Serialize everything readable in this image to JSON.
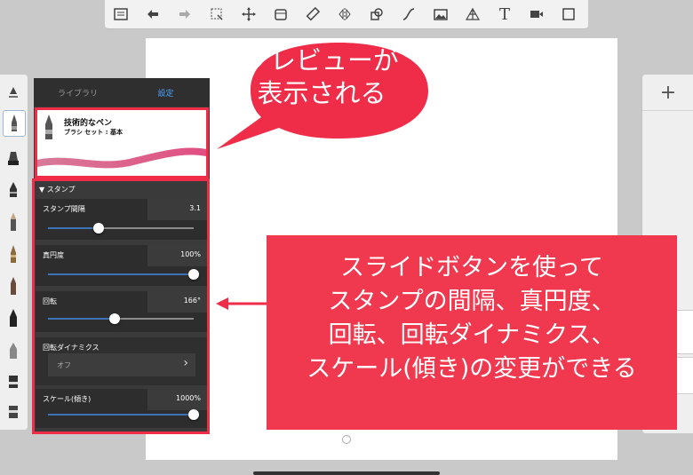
{
  "toolbar": {
    "icons": [
      "list-icon",
      "undo-icon",
      "redo-icon",
      "select-icon",
      "transform-icon",
      "layer-icon",
      "ruler-icon",
      "symmetry-icon",
      "shape-icon",
      "curve-icon",
      "image-icon",
      "perspective-icon",
      "text-icon",
      "video-icon",
      "fullscreen-icon"
    ],
    "text_tool_glyph": "T"
  },
  "brush_panel": {
    "tabs": {
      "library": "ライブラリ",
      "settings": "設定"
    },
    "preview": {
      "brush_name": "技術的なペン",
      "brush_set": "ブラシ セット : 基本"
    },
    "section": "▼ スタンプ",
    "stamp_spacing": {
      "label": "スタンプ間隔",
      "value": "3.1",
      "level": 0.35
    },
    "roundness": {
      "label": "真円度",
      "value": "100%",
      "level": 1.0
    },
    "rotation": {
      "label": "回転",
      "value": "166°",
      "level": 0.46
    },
    "rotation_dynamics": {
      "label": "回転ダイナミクス",
      "value": "オフ",
      "chevron": "›"
    },
    "scale": {
      "label": "スケール(傾き)",
      "value": "1000%",
      "level": 1.0
    }
  },
  "right_panel": {
    "add_label": "+"
  },
  "annotations": {
    "bubble_text": "プレビューが 表示される",
    "bubble_line1": "プレビューが",
    "bubble_line2": "表示される",
    "description_lines": [
      "スライドボタンを使って",
      "スタンプの間隔、真円度、",
      "回転、回転ダイナミクス、",
      "スケール(傾き)の変更ができる"
    ],
    "accent_color": "#ef2d48",
    "box_color": "#f0394f"
  }
}
